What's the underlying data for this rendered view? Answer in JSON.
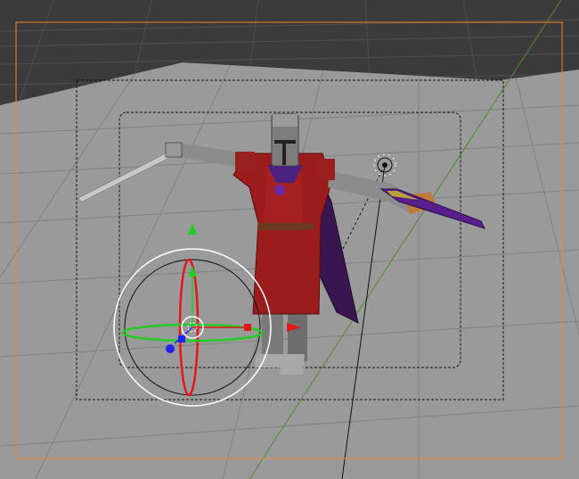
{
  "viewport": {
    "background": "#3b3b3b",
    "floor_color": "#9a9a9a",
    "grid_color": "#7e7e7e",
    "far_grid_color": "#4a4a4a",
    "x_axis_color": "#c56060",
    "y_axis_color": "#4e8a3c",
    "selection_outline_color": "#ee8a2a"
  },
  "camera": {
    "frame_line_color": "#111111",
    "frame_style": "dashed"
  },
  "character": {
    "icon": "knight-model",
    "tunic_color": "#9b1c1c",
    "cape_color": "#3a1650",
    "armor_color": "#8c8c8c"
  },
  "gizmo": {
    "icon": "rotate-translate-gizmo",
    "x_color": "#e01818",
    "y_color": "#22cc22",
    "z_color": "#2222ee",
    "ring_color": "#ffffff"
  },
  "lamp": {
    "icon": "lamp-icon"
  }
}
